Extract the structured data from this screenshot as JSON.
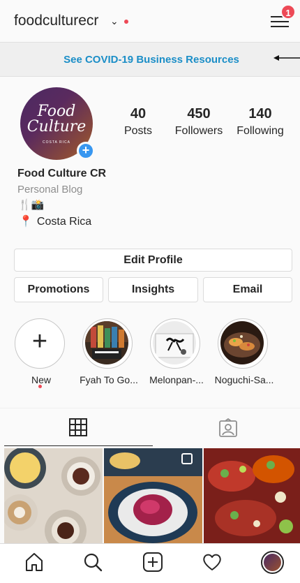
{
  "header": {
    "username": "foodculturecr",
    "chevron_icon": "chevron-down-icon",
    "notification_dot_color": "#ed4956",
    "menu_icon": "hamburger-menu-icon",
    "menu_badge": "1"
  },
  "banner": {
    "link_text": "See COVID-19 Business Resources",
    "link_color": "#1b8ec7"
  },
  "profile": {
    "avatar_title": "Food Culture",
    "avatar_subtitle": "COSTA RICA",
    "stats": [
      {
        "value": "40",
        "label": "Posts"
      },
      {
        "value": "450",
        "label": "Followers"
      },
      {
        "value": "140",
        "label": "Following"
      }
    ],
    "display_name": "Food Culture CR",
    "category": "Personal Blog",
    "bio_emoji": "🍴📸",
    "location": "Costa Rica",
    "location_icon": "pin-icon"
  },
  "actions": {
    "edit_profile": "Edit Profile",
    "promotions": "Promotions",
    "insights": "Insights",
    "email": "Email"
  },
  "highlights": [
    {
      "label": "New"
    },
    {
      "label": "Fyah To Go..."
    },
    {
      "label": "Melonpan-..."
    },
    {
      "label": "Noguchi-Sa..."
    }
  ],
  "tabs": {
    "active": "grid",
    "items": [
      "grid-icon",
      "tagged-icon"
    ]
  },
  "nav": {
    "items": [
      "home-icon",
      "search-icon",
      "new-post-icon",
      "activity-heart-icon",
      "profile-avatar"
    ]
  },
  "colors": {
    "accent_blue": "#3897f0",
    "badge_red": "#ed4956",
    "text": "#262626",
    "muted": "#8e8e8e"
  }
}
